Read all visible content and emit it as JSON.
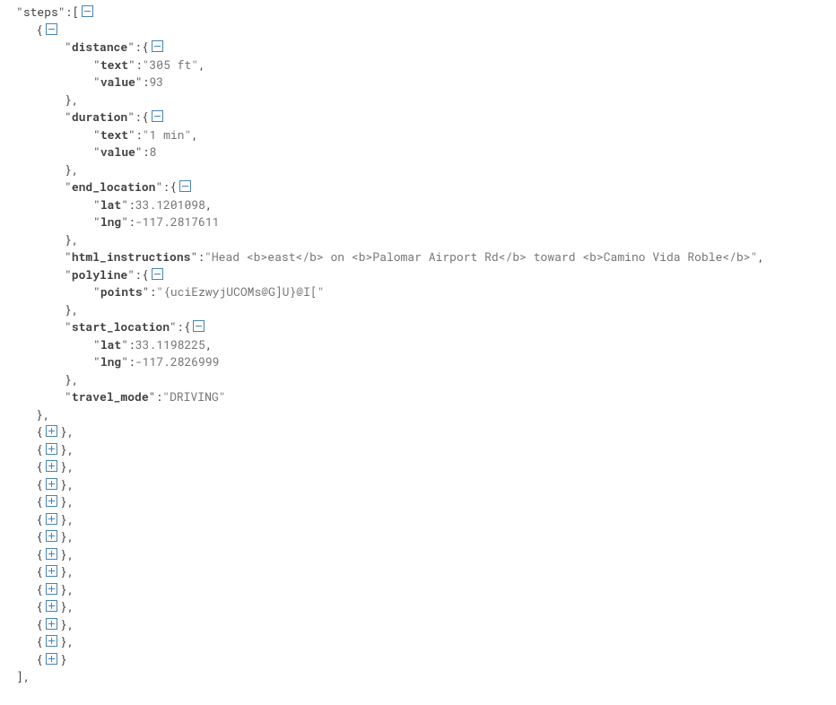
{
  "root_key": "steps",
  "step": {
    "distance": {
      "text_key": "text",
      "text_val": "305 ft",
      "value_key": "value",
      "value_val": 93
    },
    "duration": {
      "text_key": "text",
      "text_val": "1 min",
      "value_key": "value",
      "value_val": 8
    },
    "end_location": {
      "lat_key": "lat",
      "lat_val": 33.1201098,
      "lng_key": "lng",
      "lng_val": -117.2817611
    },
    "html_instructions_key": "html_instructions",
    "html_instructions_val": "Head <b>east</b> on <b>Palomar Airport Rd</b> toward <b>Camino Vida Roble</b>",
    "polyline": {
      "points_key": "points",
      "points_val": "{uciEzwyjUCOMs@G]U}@I["
    },
    "start_location": {
      "lat_key": "lat",
      "lat_val": 33.1198225,
      "lng_key": "lng",
      "lng_val": -117.2826999
    },
    "travel_mode_key": "travel_mode",
    "travel_mode_val": "DRIVING"
  },
  "labels": {
    "distance": "distance",
    "duration": "duration",
    "end_location": "end_location",
    "polyline": "polyline",
    "start_location": "start_location"
  },
  "collapsed_count": 14
}
